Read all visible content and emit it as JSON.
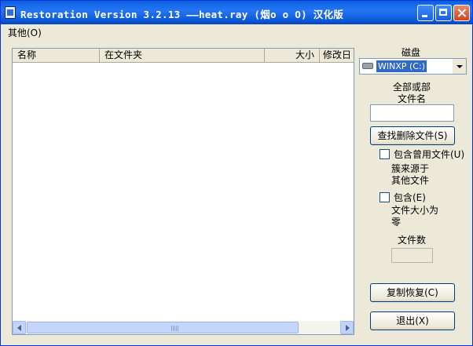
{
  "window": {
    "title": "Restoration Version 3.2.13  ——heat.ray (烟o o O) 汉化版"
  },
  "menu": {
    "items": [
      {
        "label": "其他(O)"
      }
    ]
  },
  "file_list": {
    "columns": [
      "名称",
      "在文件夹",
      "大小",
      "修改日"
    ],
    "rows": []
  },
  "disk": {
    "label": "磁盘",
    "selected": "WINXP (C:)"
  },
  "search": {
    "label_line1": "全部或部",
    "label_line2": "文件名",
    "value": "",
    "button": "查找删除文件(S)"
  },
  "options": {
    "include_used": {
      "label": "包含曾用文件(U)",
      "desc_line1": "簇来源于",
      "desc_line2": "其他文件",
      "checked": false
    },
    "include_zero": {
      "label": "包含(E)",
      "desc_line1": "文件大小为",
      "desc_line2": "零",
      "checked": false
    }
  },
  "count": {
    "label": "文件数",
    "value": ""
  },
  "actions": {
    "restore": "复制恢复(C)",
    "exit": "退出(X)"
  }
}
